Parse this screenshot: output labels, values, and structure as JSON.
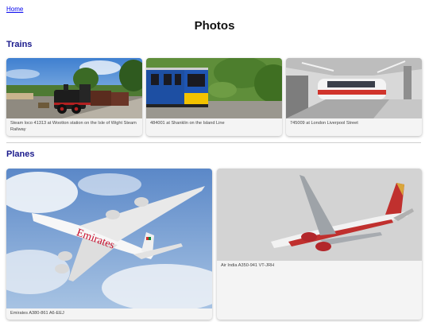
{
  "nav": {
    "home_label": "Home"
  },
  "page": {
    "title": "Photos"
  },
  "sections": {
    "trains": {
      "title": "Trains",
      "photos": [
        {
          "caption": "Steam loco 41313 at Wootton station on the Isle of Wight Steam Railway"
        },
        {
          "caption": "484001 at Shanklin on the Island Line"
        },
        {
          "caption": "745009 at London Liverpool Street"
        }
      ]
    },
    "planes": {
      "title": "Planes",
      "photos": [
        {
          "caption": "Emirates A380-861 A6-EEJ",
          "livery_text": "Emirates"
        },
        {
          "caption": "Air India A350-941 VT-JRH"
        }
      ]
    }
  }
}
